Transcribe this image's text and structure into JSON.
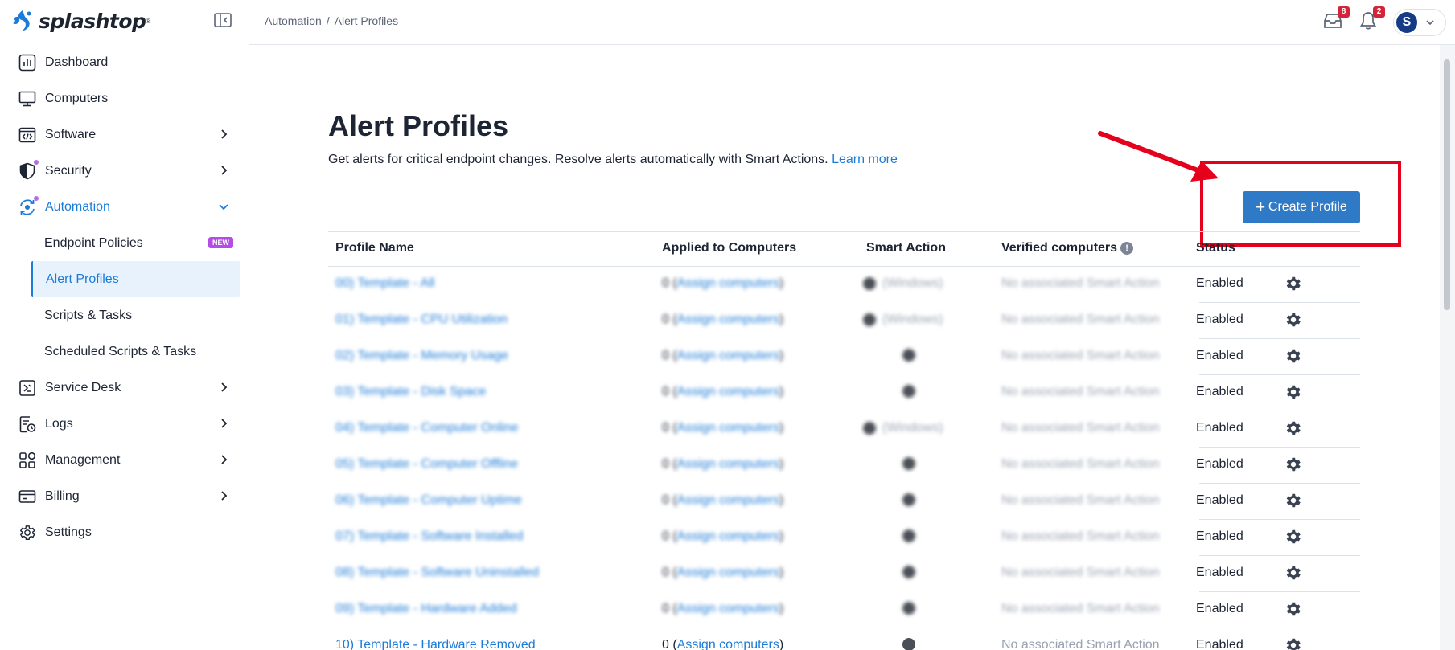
{
  "brand": {
    "name": "splashtop",
    "mark": "®",
    "color": "#1d7bd8"
  },
  "sidebar": {
    "items": [
      {
        "label": "Dashboard",
        "icon": "dashboard-icon"
      },
      {
        "label": "Computers",
        "icon": "monitor-icon"
      },
      {
        "label": "Software",
        "icon": "code-window-icon",
        "has_submenu": true
      },
      {
        "label": "Security",
        "icon": "shield-icon",
        "has_submenu": true,
        "dot": true
      },
      {
        "label": "Automation",
        "icon": "automation-icon",
        "has_submenu": true,
        "dot": true,
        "expanded": true
      },
      {
        "label": "Service Desk",
        "icon": "service-desk-icon",
        "has_submenu": true
      },
      {
        "label": "Logs",
        "icon": "logs-icon",
        "has_submenu": true
      },
      {
        "label": "Management",
        "icon": "management-icon",
        "has_submenu": true
      },
      {
        "label": "Billing",
        "icon": "billing-icon",
        "has_submenu": true
      },
      {
        "label": "Settings",
        "icon": "gear-icon"
      }
    ],
    "automation_sub": [
      {
        "label": "Endpoint Policies",
        "badge": "NEW"
      },
      {
        "label": "Alert Profiles",
        "selected": true
      },
      {
        "label": "Scripts & Tasks"
      },
      {
        "label": "Scheduled Scripts & Tasks"
      }
    ]
  },
  "header": {
    "breadcrumb": [
      "Automation",
      "Alert Profiles"
    ],
    "inbox_count": "8",
    "notifications_count": "2",
    "avatar_initial": "S"
  },
  "main": {
    "title": "Alert Profiles",
    "subtitle": "Get alerts for critical endpoint changes. Resolve alerts automatically with Smart Actions.",
    "learn_more": "Learn more",
    "create_button": "Create Profile",
    "columns": [
      "Profile Name",
      "Applied to Computers",
      "Smart Action",
      "Verified computers",
      "Status"
    ],
    "rows": [
      {
        "name": "00) Template - All",
        "applied_count": "0",
        "applied_link": "Assign computers",
        "smart": "(Windows)",
        "verified": "No associated Smart Action",
        "status": "Enabled"
      },
      {
        "name": "01) Template - CPU Utilization",
        "applied_count": "0",
        "applied_link": "Assign computers",
        "smart": "(Windows)",
        "verified": "No associated Smart Action",
        "status": "Enabled"
      },
      {
        "name": "02) Template - Memory Usage",
        "applied_count": "0",
        "applied_link": "Assign computers",
        "smart": "",
        "verified": "No associated Smart Action",
        "status": "Enabled"
      },
      {
        "name": "03) Template - Disk Space",
        "applied_count": "0",
        "applied_link": "Assign computers",
        "smart": "",
        "verified": "No associated Smart Action",
        "status": "Enabled"
      },
      {
        "name": "04) Template - Computer Online",
        "applied_count": "0",
        "applied_link": "Assign computers",
        "smart": "(Windows)",
        "verified": "No associated Smart Action",
        "status": "Enabled"
      },
      {
        "name": "05) Template - Computer Offline",
        "applied_count": "0",
        "applied_link": "Assign computers",
        "smart": "",
        "verified": "No associated Smart Action",
        "status": "Enabled"
      },
      {
        "name": "06) Template - Computer Uptime",
        "applied_count": "0",
        "applied_link": "Assign computers",
        "smart": "",
        "verified": "No associated Smart Action",
        "status": "Enabled"
      },
      {
        "name": "07) Template - Software Installed",
        "applied_count": "0",
        "applied_link": "Assign computers",
        "smart": "",
        "verified": "No associated Smart Action",
        "status": "Enabled"
      },
      {
        "name": "08) Template - Software Uninstalled",
        "applied_count": "0",
        "applied_link": "Assign computers",
        "smart": "",
        "verified": "No associated Smart Action",
        "status": "Enabled"
      },
      {
        "name": "09) Template - Hardware Added",
        "applied_count": "0",
        "applied_link": "Assign computers",
        "smart": "",
        "verified": "No associated Smart Action",
        "status": "Enabled"
      },
      {
        "name": "10) Template - Hardware Removed",
        "applied_count": "0",
        "applied_link": "Assign computers",
        "smart": "",
        "verified": "No associated Smart Action",
        "status": "Enabled"
      }
    ]
  },
  "annotation": {
    "color": "#e5001c"
  }
}
